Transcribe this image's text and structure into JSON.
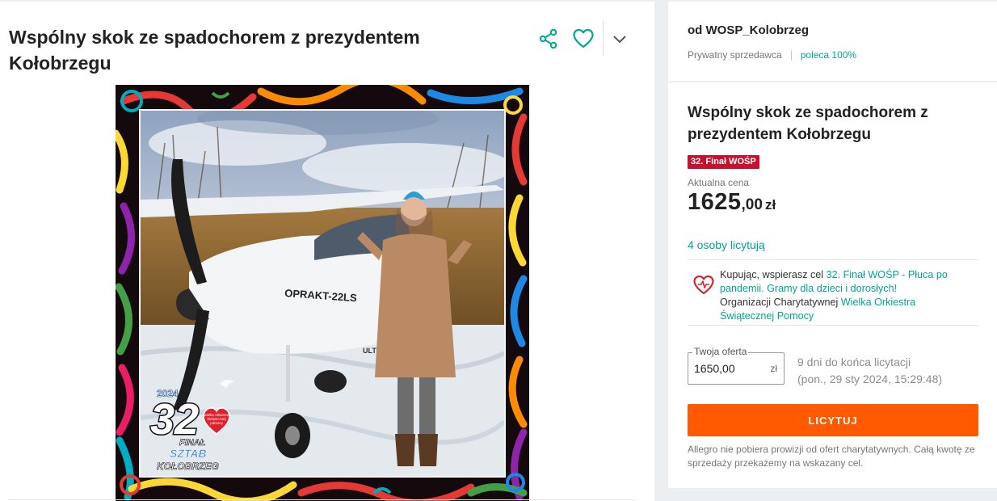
{
  "product": {
    "title": "Wspólny skok ze spadochorem z prezydentem Kołobrzegu"
  },
  "actions": {
    "share_icon": "share-icon",
    "favorite_icon": "heart-outline-icon",
    "more_icon": "chevron-down-icon"
  },
  "gallery": {
    "plane_registration": "OPRAKT-22LS",
    "plane_marking": "ULTRALE",
    "logo": {
      "year": "2024",
      "number": "32",
      "line1": "FINAŁ",
      "line2": "SZTAB",
      "line3": "KOŁOBRZEG",
      "heart_text": [
        "wielka orkiestra",
        "świątecznej",
        "pomocy"
      ]
    }
  },
  "seller": {
    "name": "od WOSP_Kolobrzeg",
    "type": "Prywatny sprzedawca",
    "recommend": "poleca 100%"
  },
  "offer": {
    "title": "Wspólny skok ze spadochorem z prezydentem Kołobrzegu",
    "badge": "32. Finał WOŚP",
    "price_label": "Aktualna cena",
    "price_int": "1625",
    "price_dec": ",00",
    "currency": "zł",
    "bidders": "4 osoby licytują"
  },
  "charity": {
    "text1": "Kupując, wspierasz cel ",
    "goal_link": "32. Finał WOŚP - Płuca po pandemii. Gramy dla dzieci i dorosłych!",
    "text2": "Organizacji Charytatywnej ",
    "org_link": "Wielka Orkiestra Świątecznej Pomocy"
  },
  "bid": {
    "legend": "Twoja oferta",
    "value": "1650,00",
    "unit": "zł",
    "time_left": "9 dni do końca licytacji",
    "end_date": "(pon., 29 sty 2024, 15:29:48)",
    "button": "LICYTUJ",
    "note": "Allegro nie pobiera prowizji od ofert charytatywnych. Całą kwotę ze sprzedaży przekażemy na wskazany cel."
  },
  "colors": {
    "accent": "#00a790",
    "buy": "#ff5a00",
    "badge": "#c8102e"
  }
}
